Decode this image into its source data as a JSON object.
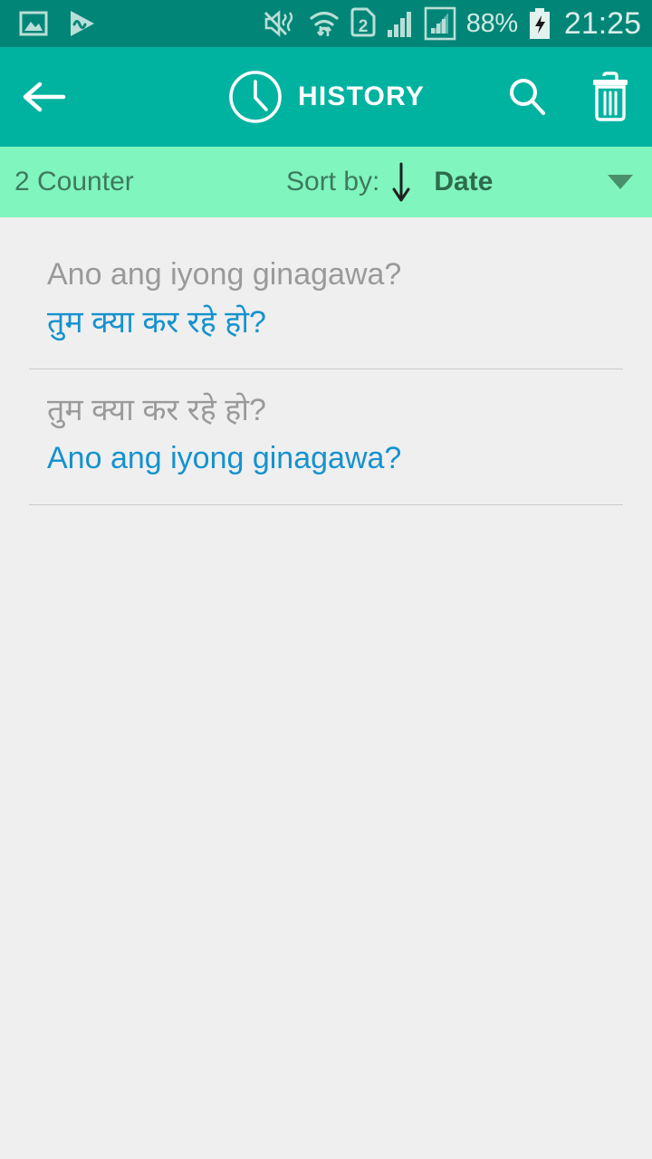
{
  "colors": {
    "status_bar_bg": "#008577",
    "app_bar_bg": "#00B3A0",
    "sort_bar_bg": "#80F5BD",
    "body_bg": "#EFEFEF",
    "source_text": "#9A9A9A",
    "target_text": "#1592CE",
    "sort_text": "#3D7A5E",
    "divider": "#C9C9C9"
  },
  "status_bar": {
    "left_icons": [
      {
        "name": "gallery-icon",
        "label": "Gallery"
      },
      {
        "name": "media-player-icon",
        "label": "Media player"
      }
    ],
    "right_icons": [
      {
        "name": "volume-mute-vibrate-icon",
        "label": "Silent / vibrate"
      },
      {
        "name": "wifi-icon",
        "label": "Wi-Fi"
      },
      {
        "name": "sim-2-icon",
        "label": "SIM 2"
      },
      {
        "name": "signal-bars-1-icon",
        "label": "Signal 1"
      },
      {
        "name": "signal-bars-2-icon",
        "label": "Signal 2"
      }
    ],
    "battery_percent": "88%",
    "battery_state": "charging",
    "clock": "21:25"
  },
  "app_bar": {
    "back_label": "Back",
    "clock_icon": "history-clock-icon",
    "title": "HISTORY",
    "search_icon": "search-icon",
    "delete_icon": "trash-icon"
  },
  "sort_bar": {
    "counter": "2 Counter",
    "sort_by_label": "Sort by:",
    "sort_direction_icon": "arrow-down-icon",
    "sort_value": "Date",
    "dropdown_icon": "chevron-down-icon"
  },
  "history": {
    "items": [
      {
        "source": "Ano ang iyong ginagawa?",
        "target": "तुम क्या कर रहे हो?"
      },
      {
        "source": "तुम क्या कर रहे हो?",
        "target": "Ano ang iyong ginagawa?"
      }
    ]
  }
}
